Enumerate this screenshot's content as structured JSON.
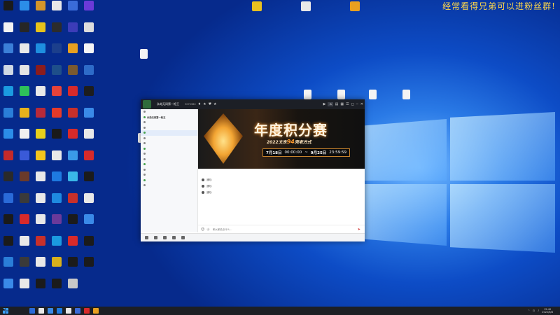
{
  "watermark": "经常看得兄弟可以进粉丝群!",
  "desktop_icons": [
    {
      "label": "",
      "color": "#1b1b1b"
    },
    {
      "label": "",
      "color": "#2b8de8"
    },
    {
      "label": "",
      "color": "#d4952a"
    },
    {
      "label": "",
      "color": "#e8e8e8"
    },
    {
      "label": "",
      "color": "#3a6bd8"
    },
    {
      "label": "",
      "color": "#6b3ad8"
    },
    {
      "label": "",
      "color": "#f3f3f3"
    },
    {
      "label": "",
      "color": "#262626"
    },
    {
      "label": "",
      "color": "#e6c21b"
    },
    {
      "label": "",
      "color": "#2c2c2c"
    },
    {
      "label": "",
      "color": "#3c3cb8"
    },
    {
      "label": "",
      "color": "#dcdcdc"
    },
    {
      "label": "",
      "color": "#3b7fd8"
    },
    {
      "label": "",
      "color": "#e9e9e9"
    },
    {
      "label": "",
      "color": "#1e8fe0"
    },
    {
      "label": "",
      "color": "#1c3f8c"
    },
    {
      "label": "",
      "color": "#e8a020"
    },
    {
      "label": "",
      "color": "#f5f5f5"
    },
    {
      "label": "",
      "color": "#cfd8e4"
    },
    {
      "label": "",
      "color": "#e4e4e4"
    },
    {
      "label": "",
      "color": "#8c1c1c"
    },
    {
      "label": "",
      "color": "#1e4f8a"
    },
    {
      "label": "",
      "color": "#7a5a30"
    },
    {
      "label": "",
      "color": "#2e6bc8"
    },
    {
      "label": "",
      "color": "#1b9ae0"
    },
    {
      "label": "",
      "color": "#2ec25a"
    },
    {
      "label": "",
      "color": "#e9e9e9"
    },
    {
      "label": "",
      "color": "#e6433a"
    },
    {
      "label": "",
      "color": "#d82a2a"
    },
    {
      "label": "",
      "color": "#1d1d1d"
    },
    {
      "label": "",
      "color": "#2a7ed8"
    },
    {
      "label": "",
      "color": "#e8b21c"
    },
    {
      "label": "",
      "color": "#b82a3a"
    },
    {
      "label": "",
      "color": "#e63a2a"
    },
    {
      "label": "",
      "color": "#c8302a"
    },
    {
      "label": "",
      "color": "#3a8ae8"
    },
    {
      "label": "",
      "color": "#2b8de8"
    },
    {
      "label": "",
      "color": "#f0f0f0"
    },
    {
      "label": "",
      "color": "#e8d01c"
    },
    {
      "label": "",
      "color": "#1a1a1a"
    },
    {
      "label": "",
      "color": "#d82a2a"
    },
    {
      "label": "",
      "color": "#e8e8e8"
    },
    {
      "label": "",
      "color": "#c42a2a"
    },
    {
      "label": "",
      "color": "#3a5ad8"
    },
    {
      "label": "",
      "color": "#f2c51c"
    },
    {
      "label": "",
      "color": "#e8e8e8"
    },
    {
      "label": "",
      "color": "#3a9ae8"
    },
    {
      "label": "",
      "color": "#d82a2a"
    },
    {
      "label": "",
      "color": "#2a2a2a"
    },
    {
      "label": "",
      "color": "#6a3a2a"
    },
    {
      "label": "",
      "color": "#e8e8e8"
    },
    {
      "label": "",
      "color": "#1e7ae0"
    },
    {
      "label": "",
      "color": "#3ab8e8"
    },
    {
      "label": "",
      "color": "#1b1b1b"
    },
    {
      "label": "",
      "color": "#2a6ad8"
    },
    {
      "label": "",
      "color": "#3a3a3a"
    },
    {
      "label": "",
      "color": "#e8e8e8"
    },
    {
      "label": "",
      "color": "#1e8ae0"
    },
    {
      "label": "",
      "color": "#c8302a"
    },
    {
      "label": "",
      "color": "#e8e8e8"
    },
    {
      "label": "",
      "color": "#1a1a1a"
    },
    {
      "label": "",
      "color": "#d82a2a"
    },
    {
      "label": "",
      "color": "#e8e8e8"
    },
    {
      "label": "",
      "color": "#6a3a9a"
    },
    {
      "label": "",
      "color": "#1b1b1b"
    },
    {
      "label": "",
      "color": "#3a8ae8"
    },
    {
      "label": "",
      "color": "#1b1b1b"
    },
    {
      "label": "",
      "color": "#e8e8e8"
    },
    {
      "label": "",
      "color": "#c8302a"
    },
    {
      "label": "",
      "color": "#1b9ae0"
    },
    {
      "label": "",
      "color": "#d82a2a"
    },
    {
      "label": "",
      "color": "#1b1b1b"
    },
    {
      "label": "",
      "color": "#2a7ed8"
    },
    {
      "label": "",
      "color": "#3a3a3a"
    },
    {
      "label": "",
      "color": "#e8e8e8"
    },
    {
      "label": "",
      "color": "#d8b01c"
    },
    {
      "label": "",
      "color": "#1b1b1b"
    },
    {
      "label": "",
      "color": "#1b1b1b"
    },
    {
      "label": "",
      "color": "#3a8ae8"
    },
    {
      "label": "",
      "color": "#e8e8e8"
    },
    {
      "label": "",
      "color": "#1b1b1b"
    },
    {
      "label": "",
      "color": "#1b1b1b"
    },
    {
      "label": "",
      "color": "#c8c8c8"
    }
  ],
  "top_icons": [
    {
      "label": "",
      "color": "#e8c020"
    },
    {
      "label": "",
      "color": "#e8e8e8"
    },
    {
      "label": "",
      "color": "#e8a020"
    }
  ],
  "app": {
    "title": "永劫无间第一枪王",
    "room_id": "3070380",
    "title_icons": [
      "♦",
      "★",
      "♥",
      "★"
    ],
    "window_controls": [
      "▶",
      "⌂",
      "▤",
      "▦",
      "☰",
      "◻",
      "─",
      "✕"
    ]
  },
  "left_panel": {
    "rows": [
      {
        "text": "",
        "type": "normal"
      },
      {
        "text": "永劫无间第一枪王",
        "type": "head"
      },
      {
        "text": "",
        "type": "normal"
      },
      {
        "text": "",
        "type": "normal"
      },
      {
        "text": "",
        "type": "sel"
      },
      {
        "text": "",
        "type": "normal"
      },
      {
        "text": "",
        "type": "normal"
      },
      {
        "text": "",
        "type": "normal"
      },
      {
        "text": "",
        "type": "normal"
      },
      {
        "text": "",
        "type": "normal"
      },
      {
        "text": "",
        "type": "normal"
      },
      {
        "text": "",
        "type": "normal"
      },
      {
        "text": "",
        "type": "normal"
      },
      {
        "text": "",
        "type": "normal"
      },
      {
        "text": "",
        "type": "normal"
      }
    ]
  },
  "banner": {
    "title": "年度积分赛",
    "sub_prefix": "2022文东",
    "sub_highlight": "94",
    "sub_suffix": "壳老方式",
    "date_start": "7月18日",
    "time_start": "00:00:00",
    "date_sep": "~",
    "date_end": "9月25日",
    "time_end": "23:59:59"
  },
  "chat": {
    "messages": [
      {
        "prefix": "通知：",
        "highlight": "",
        "text": ""
      },
      {
        "prefix": "通知：",
        "highlight": "",
        "text": ""
      },
      {
        "prefix": "通知：",
        "highlight": "",
        "text": ""
      }
    ],
    "input_placeholder": "和大家说点什么...",
    "input_icons": [
      "☺",
      "◕"
    ],
    "send_icon": "➤"
  },
  "bottom_bar": {
    "items": [
      {
        "label": ""
      },
      {
        "label": ""
      },
      {
        "label": ""
      },
      {
        "label": ""
      },
      {
        "label": ""
      }
    ],
    "right_items": [
      {
        "label": ""
      },
      {
        "label": ""
      }
    ]
  },
  "taskbar": {
    "items": [
      "#2a6ad8",
      "#e8e8e8",
      "#3a8ae8",
      "#1e7ae0",
      "#e8e8e8",
      "#3a6bd8",
      "#d82a2a",
      "#e8a020"
    ],
    "time": "15:40",
    "date": "2022/8/8"
  }
}
